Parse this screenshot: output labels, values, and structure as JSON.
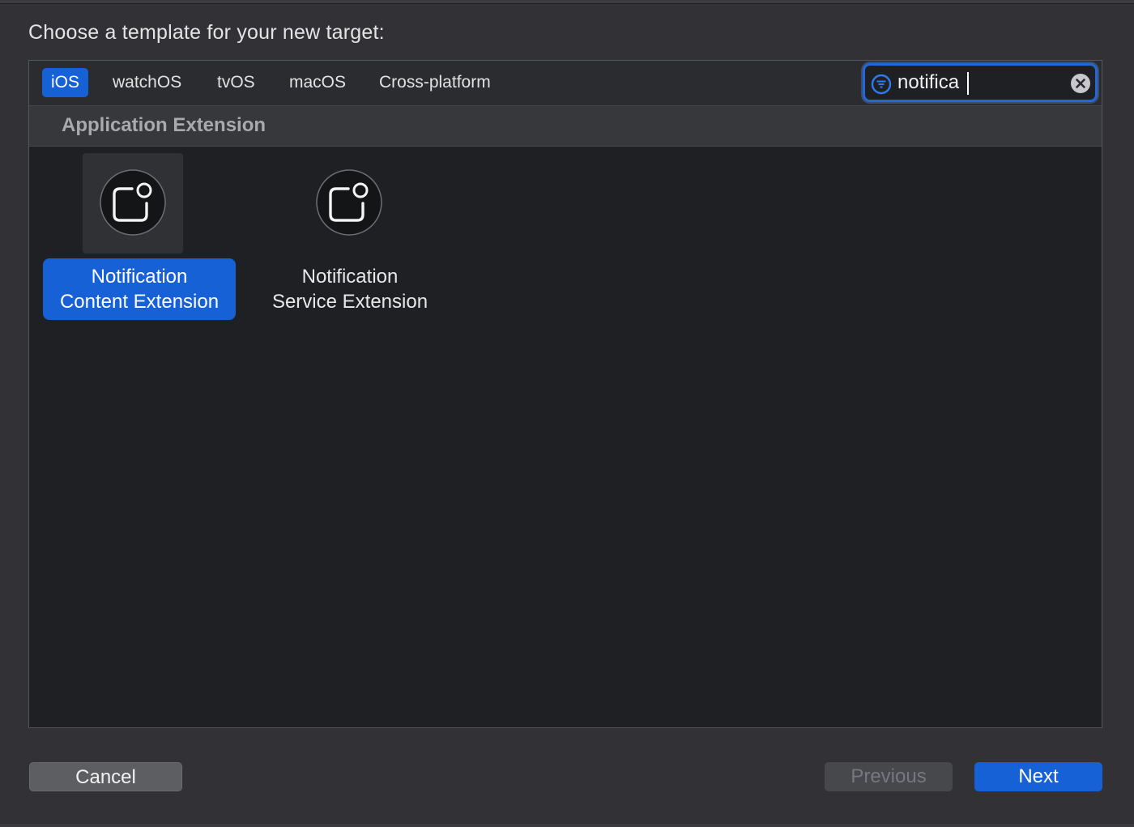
{
  "prompt": "Choose a template for your new target:",
  "tabs": [
    {
      "label": "iOS",
      "selected": true
    },
    {
      "label": "watchOS",
      "selected": false
    },
    {
      "label": "tvOS",
      "selected": false
    },
    {
      "label": "macOS",
      "selected": false
    },
    {
      "label": "Cross-platform",
      "selected": false
    }
  ],
  "search": {
    "value": "notifica",
    "filter_icon": "filter-icon",
    "clear_icon": "clear-icon"
  },
  "section": {
    "title": "Application Extension"
  },
  "templates": [
    {
      "line1": "Notification",
      "line2": "Content Extension",
      "icon": "notification-extension-icon",
      "selected": true
    },
    {
      "line1": "Notification",
      "line2": "Service Extension",
      "icon": "notification-extension-icon",
      "selected": false
    }
  ],
  "buttons": {
    "cancel": "Cancel",
    "previous": "Previous",
    "next": "Next"
  },
  "colors": {
    "accent": "#1761d6",
    "background": "#323236",
    "panel": "#1e2023"
  }
}
